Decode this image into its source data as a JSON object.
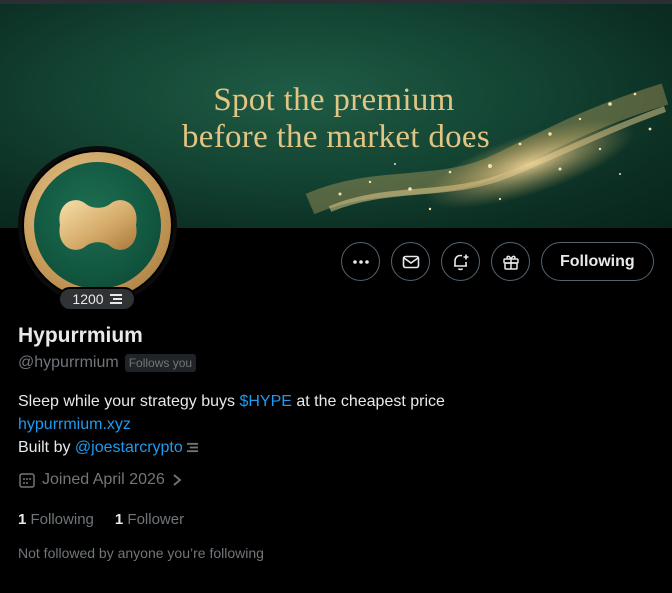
{
  "banner": {
    "line1": "Spot the premium",
    "line2": "before the market does"
  },
  "badge": {
    "count": "1200",
    "icon": "list-stack-icon"
  },
  "actions": {
    "more_icon": "more-icon",
    "message_icon": "envelope-icon",
    "notify_icon": "bell-plus-icon",
    "gift_icon": "gift-icon",
    "following_label": "Following"
  },
  "profile": {
    "name": "Hypurrmium",
    "handle": "@hypurrmium",
    "follows_you": "Follows you",
    "bio_prefix": "Sleep while your strategy buys ",
    "bio_cashtag": "$HYPE",
    "bio_suffix": " at the cheapest price",
    "link": "hypurrmium.xyz",
    "built_by_prefix": "Built by ",
    "built_by_handle": "@joestarcrypto",
    "joined": "Joined April 2026"
  },
  "stats": {
    "following_count": "1",
    "following_label": "Following",
    "followers_count": "1",
    "followers_label": "Follower"
  },
  "not_followed": "Not followed by anyone you’re following",
  "colors": {
    "accent": "#1d9bf0",
    "banner_green": "#134332",
    "gold": "#e2c483",
    "muted": "#71767b"
  }
}
